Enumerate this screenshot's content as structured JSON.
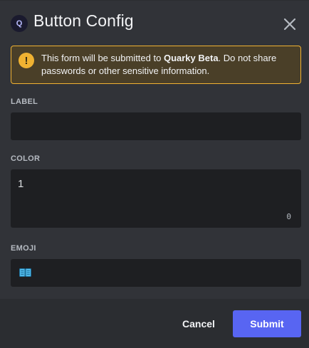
{
  "modal": {
    "app_icon_letter": "Q",
    "title": "Button Config",
    "close_icon": "close-icon"
  },
  "warning": {
    "icon": "warning-icon",
    "icon_glyph": "!",
    "text_before": "This form will be submitted to ",
    "app_name": "Quarky Beta",
    "text_after": ". Do not share passwords or other sensitive information."
  },
  "fields": {
    "label": {
      "title": "LABEL",
      "value": ""
    },
    "color": {
      "title": "COLOR",
      "value": "1",
      "char_count": "0"
    },
    "emoji": {
      "title": "EMOJI",
      "value_icon": "book-emoji-icon"
    }
  },
  "footer": {
    "cancel_label": "Cancel",
    "submit_label": "Submit"
  },
  "colors": {
    "background": "#313338",
    "input_bg": "#1e1f22",
    "footer_bg": "#2b2d31",
    "warning_bg": "#4a3f28",
    "warning_border": "#f0b232",
    "accent": "#5865f2"
  }
}
